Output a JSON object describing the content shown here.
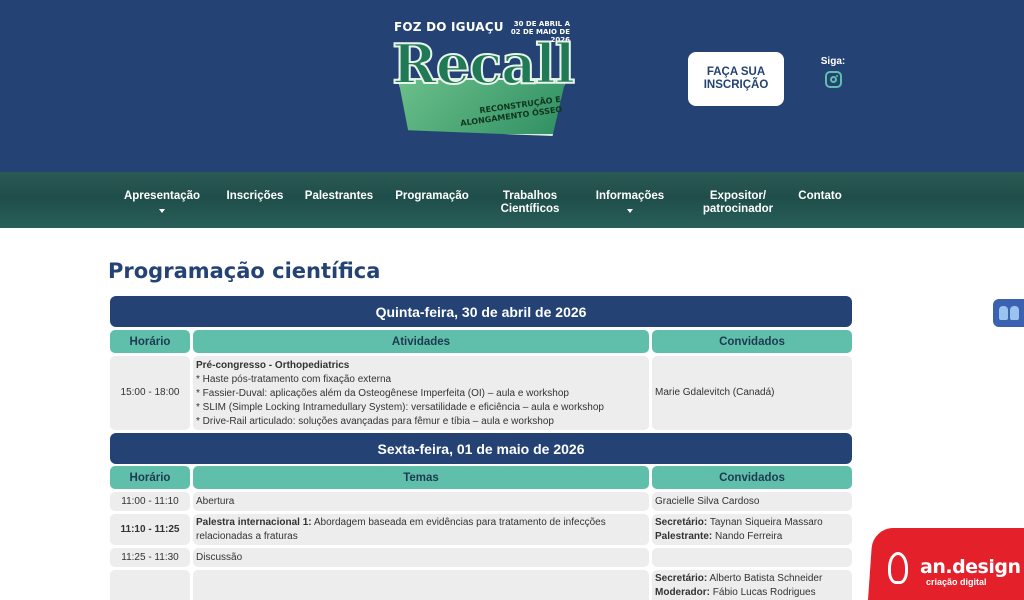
{
  "header": {
    "logo": {
      "city": "FOZ DO IGUAÇU",
      "dates": "30 DE ABRIL A 02 DE MAIO DE 2026",
      "name": "Recall",
      "subtitle": "RECONSTRUÇÃO E ALONGAMENTO ÓSSEO"
    },
    "cta_label": "FAÇA SUA INSCRIÇÃO",
    "follow_label": "Siga:",
    "social_icon": "instagram-icon"
  },
  "nav": {
    "items": [
      {
        "label": "Apresentação",
        "dropdown": true
      },
      {
        "label": "Inscrições",
        "dropdown": false
      },
      {
        "label": "Palestrantes",
        "dropdown": false
      },
      {
        "label": "Programação",
        "dropdown": false
      },
      {
        "label": "Trabalhos Científicos",
        "dropdown": false
      },
      {
        "label": "Informações",
        "dropdown": true
      },
      {
        "label": "Expositor/ patrocinador",
        "dropdown": false
      },
      {
        "label": "Contato",
        "dropdown": false
      }
    ]
  },
  "page": {
    "title": "Programação científica"
  },
  "days": [
    {
      "title": "Quinta-feira, 30 de abril de 2026",
      "columns": [
        "Horário",
        "Atividades",
        "Convidados"
      ],
      "rows": [
        {
          "time": "15:00 - 18:00",
          "title": "Pré-congresso - Orthopediatrics",
          "lines": [
            "* Haste pós-tratamento com fixação externa",
            "* Fassier-Duval: aplicações além da Osteogênese Imperfeita (OI) – aula e workshop",
            "* SLIM (Simple Locking Intramedullary System): versatilidade e eficiência – aula e workshop",
            "* Drive-Rail articulado: soluções avançadas para fêmur e tíbia – aula e workshop"
          ],
          "guests": "Marie Gdalevitch (Canadá)"
        }
      ]
    },
    {
      "title": "Sexta-feira, 01 de maio de 2026",
      "columns": [
        "Horário",
        "Temas",
        "Convidados"
      ],
      "rows": [
        {
          "time": "11:00 - 11:10",
          "topic": "Abertura",
          "guests": "Gracielle Silva Cardoso"
        },
        {
          "time": "11:10 - 11:25",
          "topic_label": "Palestra internacional 1:",
          "topic": "Abordagem baseada em evidências para tratamento de infecções relacionadas a fraturas",
          "guest_lines": [
            {
              "role": "Secretário:",
              "name": "Taynan Siqueira Massaro"
            },
            {
              "role": "Palestrante:",
              "name": "Nando Ferreira"
            }
          ]
        },
        {
          "time": "11:25 - 11:30",
          "topic": "Discussão",
          "guests": ""
        },
        {
          "time": "",
          "topic": "",
          "guest_lines": [
            {
              "role": "Secretário:",
              "name": "Alberto Batista Schneider"
            },
            {
              "role": "Moderador:",
              "name": "Fábio Lucas Rodrigues"
            }
          ]
        }
      ]
    }
  ],
  "widgets": {
    "side_icon": "team-photo-icon",
    "brand": {
      "name": "an.design",
      "tagline": "criação digital"
    }
  },
  "colors": {
    "header_bg": "#244374",
    "nav_bg": "#2b5a55",
    "column_header": "#5fbfaa",
    "cell_bg": "#ededed",
    "brand_red": "#e4212a"
  }
}
